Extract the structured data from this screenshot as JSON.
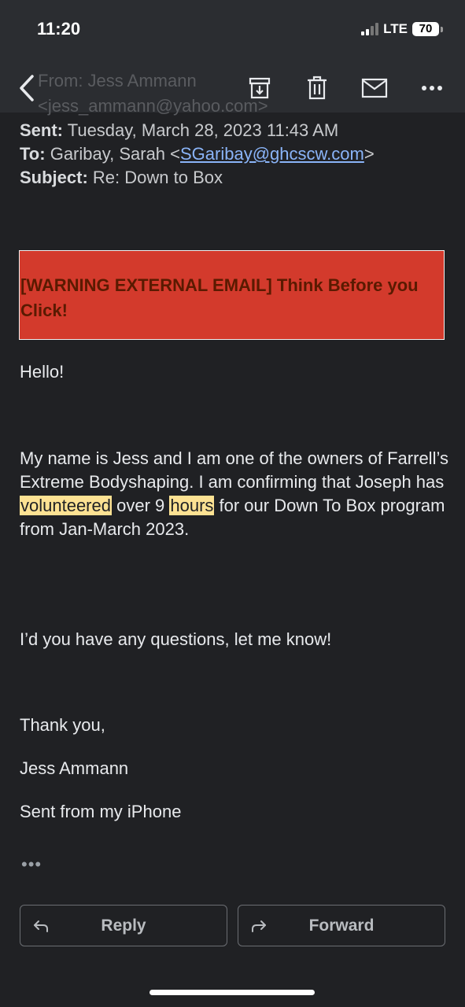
{
  "status": {
    "time": "11:20",
    "network": "LTE",
    "battery": "70"
  },
  "toolbar": {
    "icons": [
      "back-icon",
      "archive-icon",
      "trash-icon",
      "mail-icon",
      "more-icon"
    ]
  },
  "ghost": {
    "from": "From: Jess Ammann",
    "email": "<jess_ammann@yahoo.com>"
  },
  "email": {
    "sent_label": "Sent:",
    "sent_value": "Tuesday, March 28, 2023 11:43 AM",
    "to_label": "To:",
    "to_name": "Garibay, Sarah <",
    "to_email": "SGaribay@ghcscw.com",
    "to_close": ">",
    "subject_label": "Subject:",
    "subject_value": "Re: Down to Box",
    "warning": "[WARNING EXTERNAL EMAIL] Think Before you Click!",
    "greeting": "Hello!",
    "para_1a": "My name is Jess and I am one of the owners of Farrell’s Extreme Bodyshaping.  I am confirming that Joseph has ",
    "para_1_hl1": "volunteered",
    "para_1b": " over 9 ",
    "para_1_hl2": "hours",
    "para_1c": " for our Down To Box program from Jan-March 2023.",
    "para_2": "I’d you have any questions, let me know!",
    "closing": "Thank you,",
    "signature": "Jess Ammann",
    "sent_from": "Sent from my iPhone",
    "more_dots": "•••"
  },
  "actions": {
    "reply": "Reply",
    "forward": "Forward"
  },
  "colors": {
    "background": "#202124",
    "warning": "#d33a2c",
    "highlight": "#fde293",
    "link": "#8ab4f8"
  }
}
